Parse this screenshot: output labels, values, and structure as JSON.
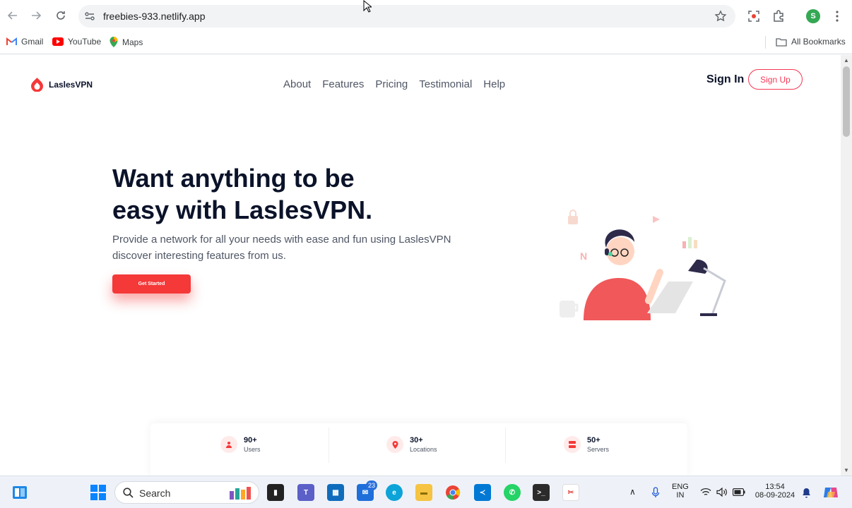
{
  "browser": {
    "url": "freebies-933.netlify.app",
    "profile_initial": "S",
    "bookmarks": [
      {
        "label": "Gmail",
        "icon": "gmail-icon"
      },
      {
        "label": "YouTube",
        "icon": "youtube-icon"
      },
      {
        "label": "Maps",
        "icon": "maps-icon"
      }
    ],
    "all_bookmarks": "All Bookmarks"
  },
  "site": {
    "brand": "LaslesVPN",
    "nav": [
      "About",
      "Features",
      "Pricing",
      "Testimonial",
      "Help"
    ],
    "sign_in": "Sign In",
    "sign_up": "Sign Up",
    "hero": {
      "title_line1": "Want anything to be",
      "title_line2": "easy with LaslesVPN.",
      "subtitle_line1": "Provide a network for all your needs with ease and fun using LaslesVPN",
      "subtitle_line2": "discover interesting features from us.",
      "cta": "Get Started"
    },
    "stats": [
      {
        "value": "90+",
        "label": "Users",
        "icon": "user-icon"
      },
      {
        "value": "30+",
        "label": "Locations",
        "icon": "location-icon"
      },
      {
        "value": "50+",
        "label": "Servers",
        "icon": "server-icon"
      }
    ],
    "colors": {
      "accent": "#F53838",
      "dark": "#0B132A",
      "muted": "#4F5665"
    }
  },
  "taskbar": {
    "search_label": "Search",
    "teams_badge": "23",
    "lang_line1": "ENG",
    "lang_line2": "IN",
    "time": "13:54",
    "date": "08-09-2024"
  }
}
